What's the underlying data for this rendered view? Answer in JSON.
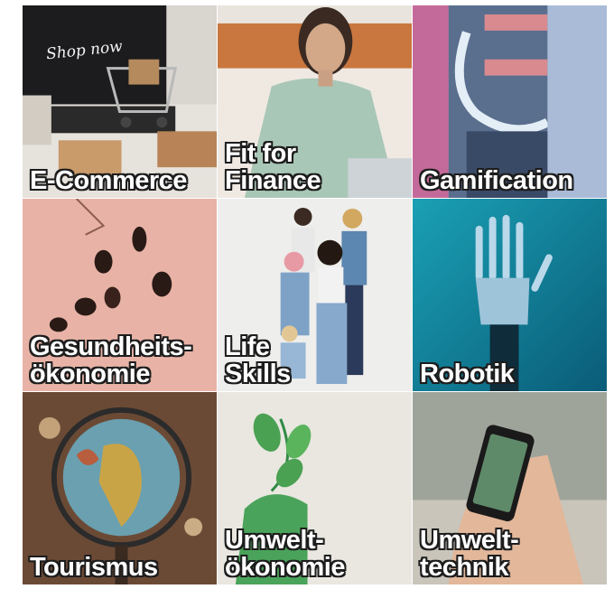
{
  "tiles": [
    {
      "lines": [
        "E-Commerce"
      ],
      "sign_text": "Shop now"
    },
    {
      "lines": [
        "Fit for",
        "Finance"
      ]
    },
    {
      "lines": [
        "Gamification"
      ]
    },
    {
      "lines": [
        "Gesundheits-",
        "ökonomie"
      ]
    },
    {
      "lines": [
        "Life",
        "Skills"
      ]
    },
    {
      "lines": [
        "Robotik"
      ]
    },
    {
      "lines": [
        "Tourismus"
      ]
    },
    {
      "lines": [
        "Umwelt-",
        "ökonomie"
      ]
    },
    {
      "lines": [
        "Umwelt-",
        "technik"
      ]
    }
  ],
  "colors": {
    "label_text": "#ffffff",
    "label_outline": "#1d1d1d"
  }
}
